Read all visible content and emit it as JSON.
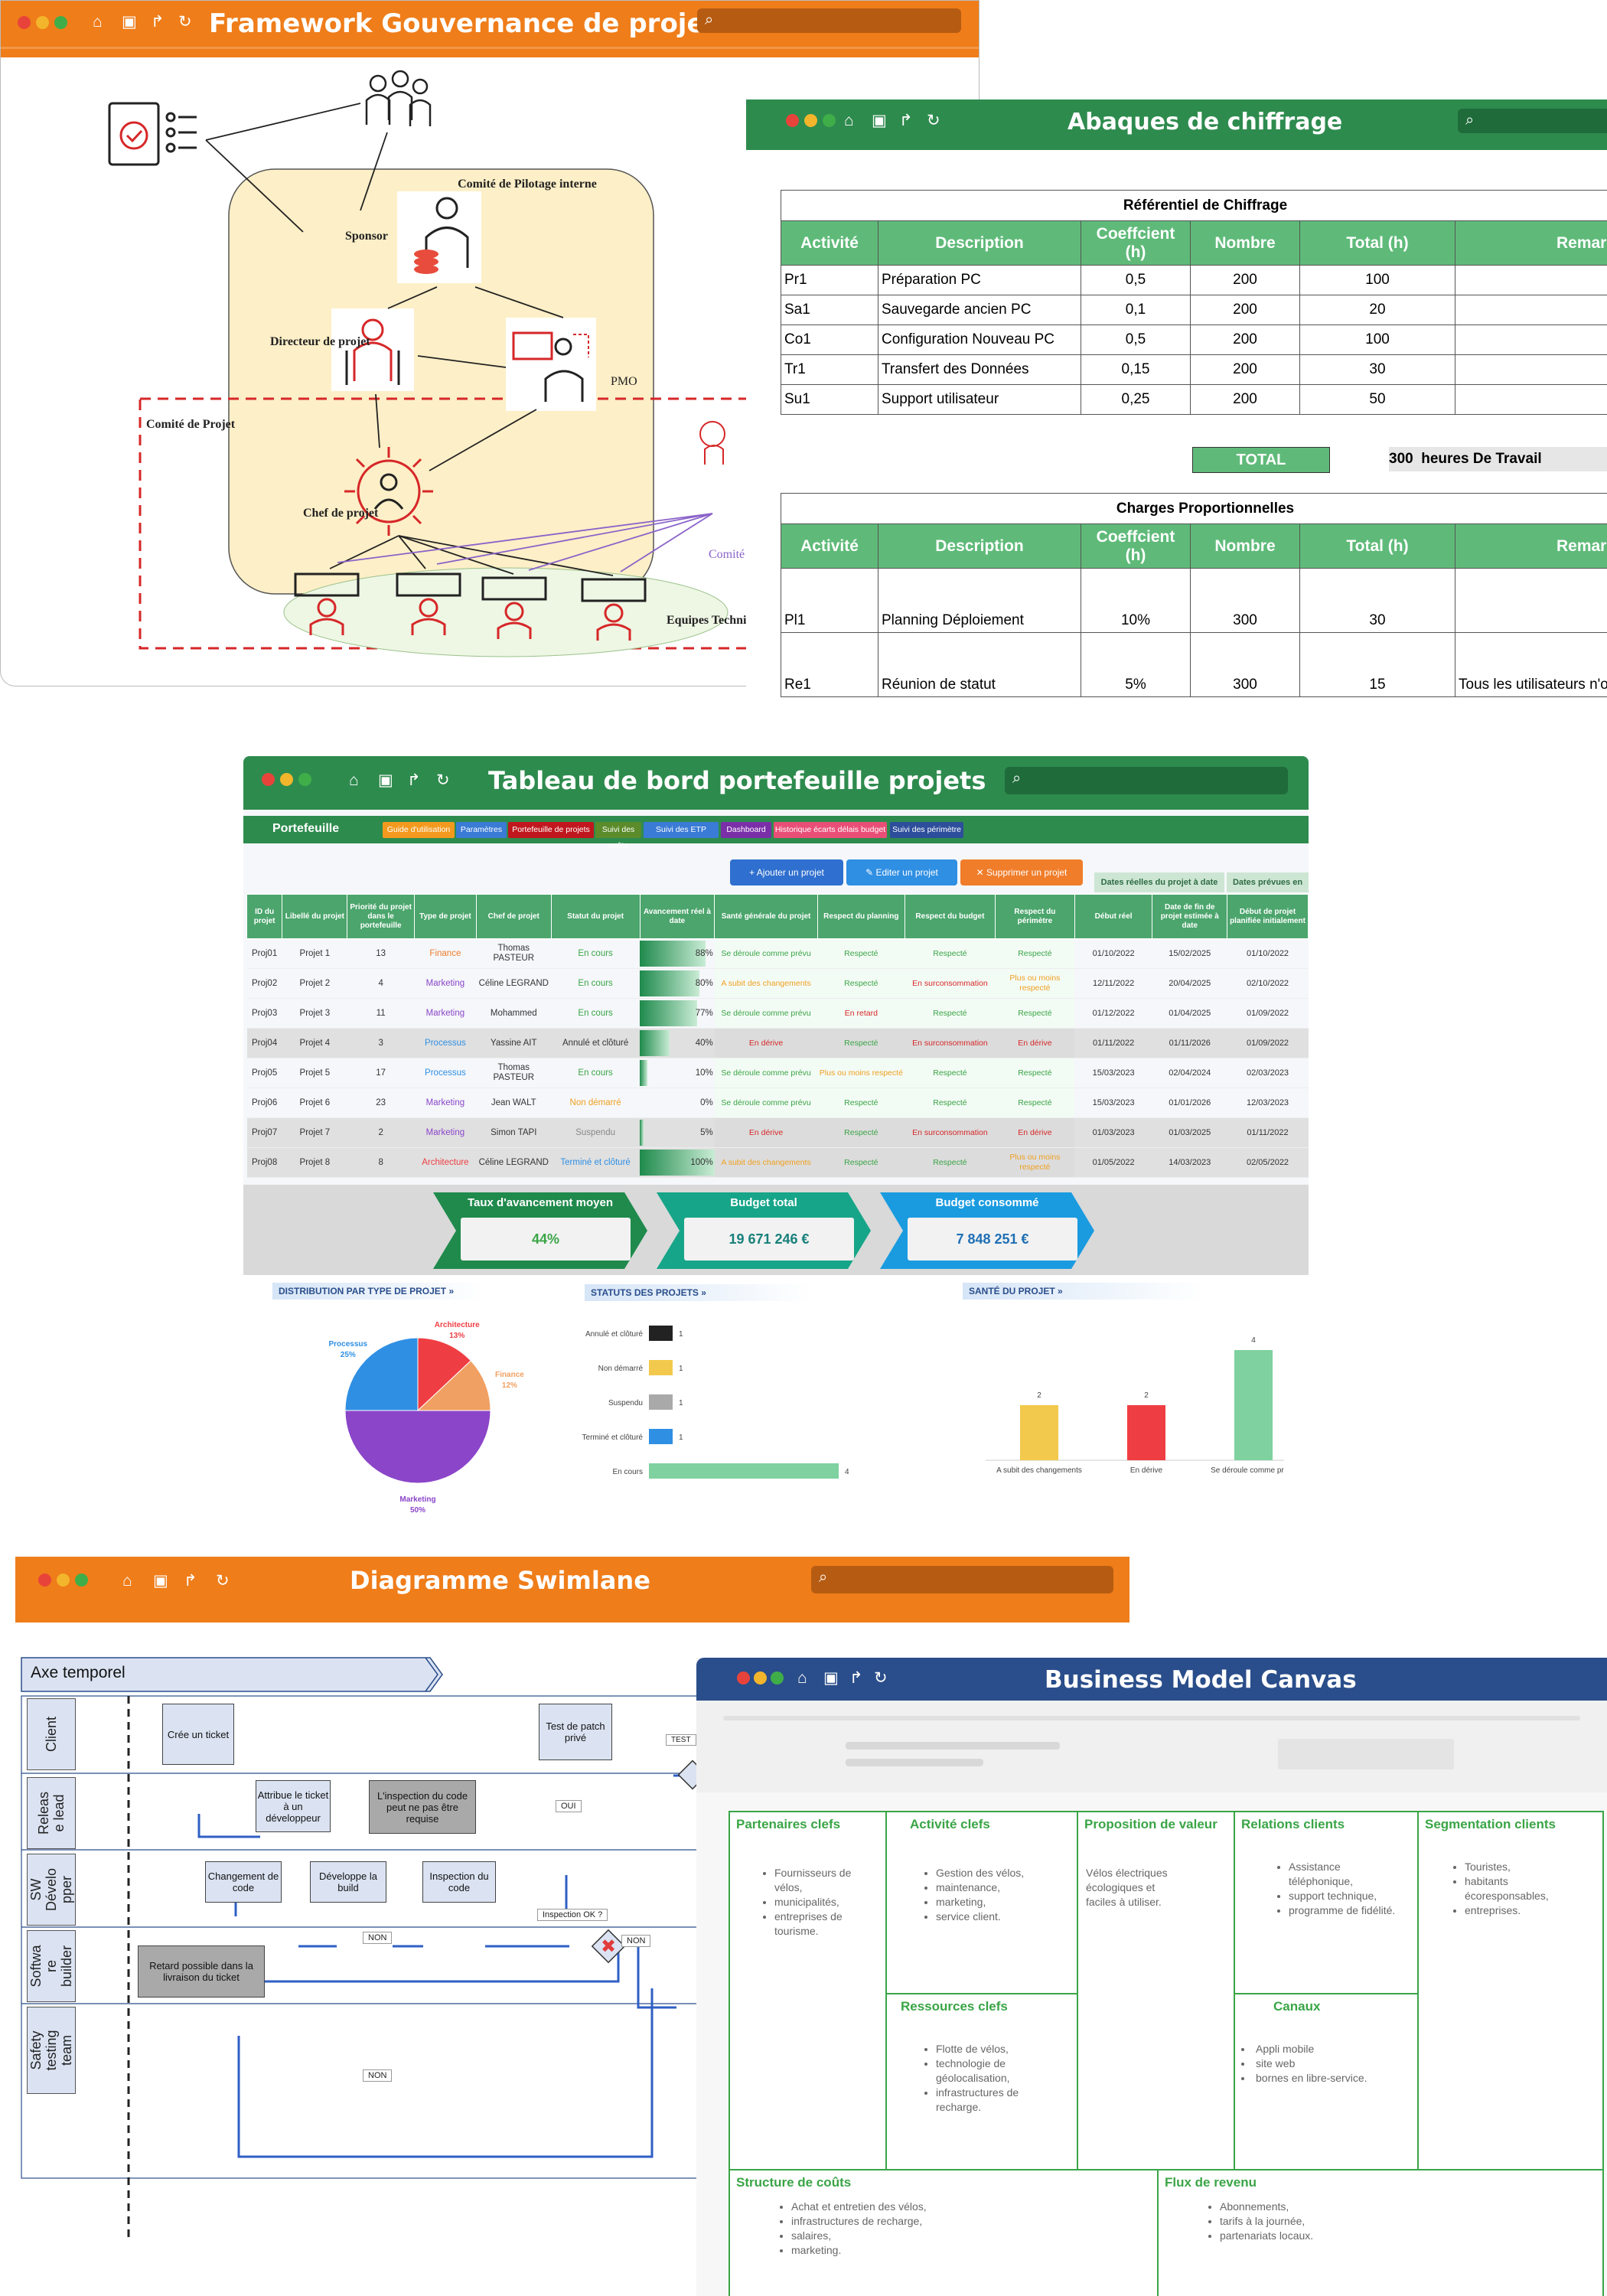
{
  "windows": {
    "framework": {
      "title": "Framework Gouvernance de projet"
    },
    "abaques": {
      "title": "Abaques de chiffrage"
    },
    "dashboard": {
      "title": "Tableau de bord portefeuille projets"
    },
    "swimlane": {
      "title": "Diagramme Swimlane"
    },
    "bmc": {
      "title": "Business Model Canvas"
    }
  },
  "governance": {
    "comite_pilotage": "Comité de Pilotage interne",
    "sponsor": "Sponsor",
    "directeur": "Directeur de projet",
    "pmo": "PMO",
    "comite_projet": "Comité de Projet",
    "chef": "Chef de projet",
    "equipes": "Equipes Technique",
    "comite_partial": "Comité"
  },
  "abaques": {
    "ref_caption": "Référentiel de Chiffrage",
    "headers": [
      "Activité",
      "Description",
      "Coeffcient (h)",
      "Nombre",
      "Total (h)",
      "Remarqu"
    ],
    "rows": [
      {
        "act": "Pr1",
        "desc": "Préparation PC",
        "coef": "0,5",
        "nb": "200",
        "tot": "100"
      },
      {
        "act": "Sa1",
        "desc": "Sauvegarde ancien PC",
        "coef": "0,1",
        "nb": "200",
        "tot": "20"
      },
      {
        "act": "Co1",
        "desc": "Configuration Nouveau PC",
        "coef": "0,5",
        "nb": "200",
        "tot": "100"
      },
      {
        "act": "Tr1",
        "desc": "Transfert des Données",
        "coef": "0,15",
        "nb": "200",
        "tot": "30"
      },
      {
        "act": "Su1",
        "desc": "Support utilisateur",
        "coef": "0,25",
        "nb": "200",
        "tot": "50"
      }
    ],
    "total_label": "TOTAL",
    "total_value": "300  heures De Travail",
    "charges_caption": "Charges Proportionnelles",
    "charges_rows": [
      {
        "act": "Pl1",
        "desc": "Planning Déploiement",
        "coef": "10%",
        "nb": "300",
        "tot": "30",
        "rem": ""
      },
      {
        "act": "Re1",
        "desc": "Réunion de statut",
        "coef": "5%",
        "nb": "300",
        "tot": "15",
        "rem": "Tous les utilisateurs n'on"
      }
    ]
  },
  "dashboard": {
    "section": "Portefeuille",
    "tabs": [
      {
        "label": "Guide d'utilisation",
        "color": "#f39a1e"
      },
      {
        "label": "Paramètres",
        "color": "#3a7bd5"
      },
      {
        "label": "Portefeuille de projets",
        "color": "#c0161d"
      },
      {
        "label": "Suivi des coûts",
        "color": "#5b8b2a"
      },
      {
        "label": "Suivi des ETP",
        "color": "#3a7bd5"
      },
      {
        "label": "Dashboard",
        "color": "#7a2fa8"
      },
      {
        "label": "Historique écarts délais budget",
        "color": "#e94e77"
      },
      {
        "label": "Suivi des périmètre",
        "color": "#2d4e9b"
      }
    ],
    "actions": {
      "add": "+  Ajouter un projet",
      "edit": "✎  Editer un projet",
      "delete": "✕  Supprimer un projet"
    },
    "date_groups": {
      "real": "Dates réelles du projet à date",
      "planned": "Dates prévues en"
    },
    "columns": [
      "ID du projet",
      "Libellé du projet",
      "Priorité du projet dans le portefeuille",
      "Type de projet",
      "Chef de projet",
      "Statut du projet",
      "Avancement réel à date",
      "Santé générale du projet",
      "Respect du planning",
      "Respect du budget",
      "Respect du périmètre",
      "Début réel",
      "Date de fin de projet estimée à date",
      "Début de projet planifiée initialement"
    ],
    "rows": [
      {
        "id": "Proj01",
        "lib": "Projet 1",
        "prio": "13",
        "type": "Finance",
        "chef": "Thomas PASTEUR",
        "statut": "En cours",
        "av": "88%",
        "sante": "Se déroule comme prévu",
        "plan": "Respecté",
        "bud": "Respecté",
        "per": "Respecté",
        "d1": "01/10/2022",
        "d2": "15/02/2025",
        "d3": "01/10/2022"
      },
      {
        "id": "Proj02",
        "lib": "Projet 2",
        "prio": "4",
        "type": "Marketing",
        "chef": "Céline LEGRAND",
        "statut": "En cours",
        "av": "80%",
        "sante": "A subit des changements",
        "plan": "Respecté",
        "bud": "En surconsommation",
        "per": "Plus ou moins respecté",
        "d1": "12/11/2022",
        "d2": "20/04/2025",
        "d3": "02/10/2022"
      },
      {
        "id": "Proj03",
        "lib": "Projet 3",
        "prio": "11",
        "type": "Marketing",
        "chef": "Mohammed",
        "statut": "En cours",
        "av": "77%",
        "sante": "Se déroule comme prévu",
        "plan": "En retard",
        "bud": "Respecté",
        "per": "Respecté",
        "d1": "01/12/2022",
        "d2": "01/04/2025",
        "d3": "01/09/2022"
      },
      {
        "id": "Proj04",
        "lib": "Projet 4",
        "prio": "3",
        "type": "Processus",
        "chef": "Yassine AIT",
        "statut": "Annulé et clôturé",
        "av": "40%",
        "sante": "En dérive",
        "plan": "Respecté",
        "bud": "En surconsommation",
        "per": "En dérive",
        "d1": "01/11/2022",
        "d2": "01/11/2026",
        "d3": "01/09/2022"
      },
      {
        "id": "Proj05",
        "lib": "Projet 5",
        "prio": "17",
        "type": "Processus",
        "chef": "Thomas PASTEUR",
        "statut": "En cours",
        "av": "10%",
        "sante": "Se déroule comme prévu",
        "plan": "Plus ou moins respecté",
        "bud": "Respecté",
        "per": "Respecté",
        "d1": "15/03/2023",
        "d2": "02/04/2024",
        "d3": "02/03/2023"
      },
      {
        "id": "Proj06",
        "lib": "Projet 6",
        "prio": "23",
        "type": "Marketing",
        "chef": "Jean WALT",
        "statut": "Non démarré",
        "av": "0%",
        "sante": "Se déroule comme prévu",
        "plan": "Respecté",
        "bud": "Respecté",
        "per": "Respecté",
        "d1": "15/03/2023",
        "d2": "01/01/2026",
        "d3": "12/03/2023"
      },
      {
        "id": "Proj07",
        "lib": "Projet 7",
        "prio": "2",
        "type": "Marketing",
        "chef": "Simon TAPI",
        "statut": "Suspendu",
        "av": "5%",
        "sante": "En dérive",
        "plan": "Respecté",
        "bud": "En surconsommation",
        "per": "En dérive",
        "d1": "01/03/2023",
        "d2": "01/03/2025",
        "d3": "01/11/2022"
      },
      {
        "id": "Proj08",
        "lib": "Projet 8",
        "prio": "8",
        "type": "Architecture",
        "chef": "Céline LEGRAND",
        "statut": "Terminé et clôturé",
        "av": "100%",
        "sante": "A subit des changements",
        "plan": "Respecté",
        "bud": "Respecté",
        "per": "Plus ou moins respecté",
        "d1": "01/05/2022",
        "d2": "14/03/2023",
        "d3": "02/05/2022"
      }
    ],
    "kpis": [
      {
        "label": "Taux d'avancement moyen",
        "value": "44%",
        "color": "#1f8a4c",
        "vcolor": "#3aa546"
      },
      {
        "label": "Budget total",
        "value": "19 671 246 €",
        "color": "#17a589",
        "vcolor": "#17807a"
      },
      {
        "label": "Budget consommé",
        "value": "7 848 251 €",
        "color": "#1a9be0",
        "vcolor": "#1f6fb5"
      }
    ],
    "chart_titles": {
      "dist": "DISTRIBUTION PAR TYPE DE PROJET »",
      "status": "STATUTS DES PROJETS »",
      "health": "SANTÉ DU PROJET »"
    }
  },
  "chart_data": [
    {
      "type": "pie",
      "title": "DISTRIBUTION PAR TYPE DE PROJET »",
      "categories": [
        "Marketing",
        "Processus",
        "Architecture",
        "Finance"
      ],
      "values": [
        50,
        25,
        13,
        12
      ],
      "labels": [
        "50%",
        "25%",
        "13%",
        "12%"
      ],
      "colors": [
        "#8b45c9",
        "#2f8fe3",
        "#ef3e43",
        "#f0a062"
      ]
    },
    {
      "type": "bar",
      "orientation": "horizontal",
      "title": "STATUTS DES PROJETS »",
      "categories": [
        "Annulé et clôturé",
        "Non démarré",
        "Suspendu",
        "Terminé et clôturé",
        "En cours"
      ],
      "values": [
        1,
        1,
        1,
        1,
        4
      ],
      "colors": [
        "#222222",
        "#f2c94c",
        "#a9a9a9",
        "#2f8fe3",
        "#7fd1a0"
      ]
    },
    {
      "type": "bar",
      "title": "SANTÉ DU PROJET »",
      "categories": [
        "A subit des changements",
        "En dérive",
        "Se déroule comme prévu"
      ],
      "values": [
        2,
        2,
        4
      ],
      "colors": [
        "#f2c94c",
        "#ef3e43",
        "#7fd1a0"
      ]
    }
  ],
  "swimlane": {
    "axis": "Axe temporel",
    "lanes": [
      "Client",
      "Releas e lead",
      "SW Dévelo pper",
      "Softwa re builder",
      "Safety testing team"
    ],
    "boxes": {
      "cree": "Crée un ticket",
      "attribue": "Attribue le ticket à un développeur",
      "inspection_note": "L'inspection du code peut ne pas être requise",
      "test": "Test de patch privé",
      "changement": "Changement de code",
      "developpe": "Développe la build",
      "inspection": "Inspection du code",
      "retard": "Retard possible dans la livraison du ticket"
    },
    "labels": {
      "oui": "OUI",
      "non": "NON",
      "inspection_ok": "Inspection OK ?",
      "test_partial": "TEST"
    }
  },
  "bmc": {
    "partenaires": {
      "title": "Partenaires clefs",
      "items": [
        "Fournisseurs de vélos,",
        "municipalités,",
        "entreprises de tourisme."
      ]
    },
    "activites": {
      "title": "Activité clefs",
      "items": [
        "Gestion des vélos,",
        "maintenance,",
        "marketing,",
        "service client."
      ]
    },
    "proposition": {
      "title": "Proposition de valeur",
      "text": "Vélos électriques écologiques et faciles à utiliser."
    },
    "relations": {
      "title": "Relations clients",
      "items": [
        "Assistance téléphonique,",
        "support technique,",
        "programme de fidélité."
      ]
    },
    "segmentation": {
      "title": "Segmentation clients",
      "items": [
        "Touristes,",
        "habitants écoresponsables,",
        "entreprises."
      ]
    },
    "ressources": {
      "title": "Ressources clefs",
      "items": [
        "Flotte de vélos,",
        "technologie de géolocalisation,",
        "infrastructures de recharge."
      ]
    },
    "canaux": {
      "title": "Canaux",
      "items": [
        "Appli mobile",
        "site web",
        "bornes en libre-service."
      ]
    },
    "couts": {
      "title": "Structure de coûts",
      "items": [
        "Achat et entretien des vélos,",
        "infrastructures de recharge,",
        "salaires,",
        "marketing."
      ]
    },
    "revenu": {
      "title": "Flux de revenu",
      "items": [
        "Abonnements,",
        "tarifs à la journée,",
        "partenariats locaux."
      ]
    }
  },
  "colors": {
    "orange": "#ef7d1a",
    "green": "#2e8b4e",
    "blue": "#2a4e8b",
    "bmc_green": "#3aa546"
  }
}
